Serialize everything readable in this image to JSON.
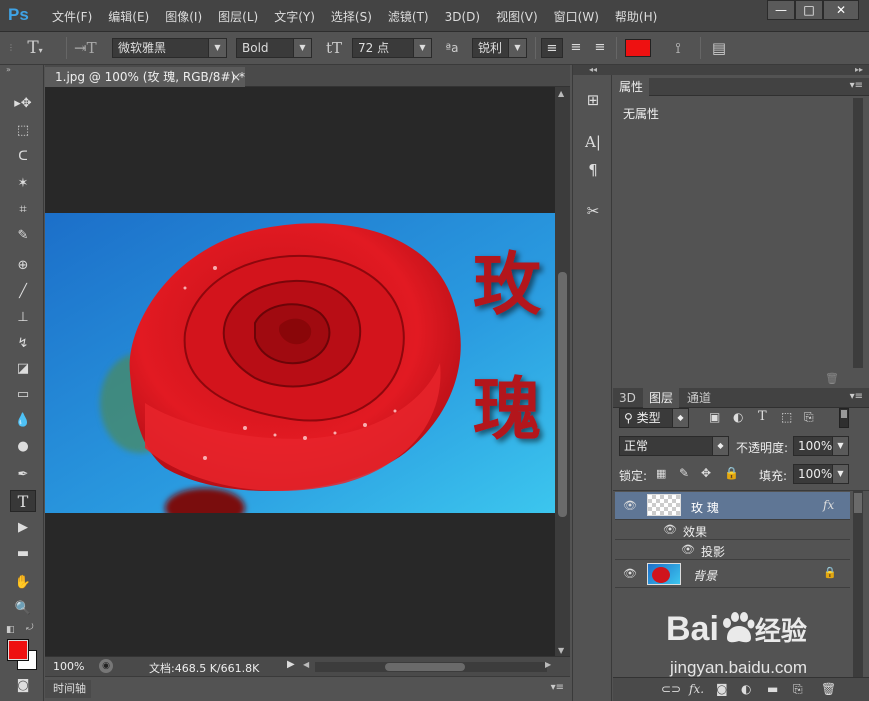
{
  "app": {
    "logo": "Ps",
    "menu": [
      "文件(F)",
      "编辑(E)",
      "图像(I)",
      "图层(L)",
      "文字(Y)",
      "选择(S)",
      "滤镜(T)",
      "3D(D)",
      "视图(V)",
      "窗口(W)",
      "帮助(H)"
    ],
    "window_buttons": [
      "—",
      "□",
      "✕"
    ]
  },
  "options": {
    "font_family": "微软雅黑",
    "font_style": "Bold",
    "font_size": "72 点",
    "antialias": "锐利",
    "aa_label": "ªa",
    "text_color": "#ee1111"
  },
  "document": {
    "tab_title": "1.jpg @ 100% (玫 瑰, RGB/8#) *",
    "close_glyph": "×",
    "canvas_text": [
      "玫",
      "瑰"
    ],
    "zoom": "100%",
    "doc_info": "文档:468.5 K/661.8K",
    "timeline_tab": "时间轴"
  },
  "properties": {
    "tab": "属性",
    "body": "无属性"
  },
  "layers": {
    "tabs": [
      "3D",
      "图层",
      "通道"
    ],
    "filter_kind": "类型",
    "blend_mode": "正常",
    "opacity_label": "不透明度:",
    "opacity": "100%",
    "lock_label": "锁定:",
    "fill_label": "填充:",
    "fill": "100%",
    "items": [
      {
        "name": "玫 瑰",
        "fx": "fx"
      },
      {
        "name": "效果"
      },
      {
        "name": "投影"
      },
      {
        "name": "背景"
      }
    ]
  },
  "watermark": {
    "brand": "Bai",
    "brand_du": "经验",
    "url": "jingyan.baidu.com"
  },
  "colors": {
    "foreground": "#ee1111",
    "background": "#ffffff",
    "accent": "#3fa3e6"
  }
}
